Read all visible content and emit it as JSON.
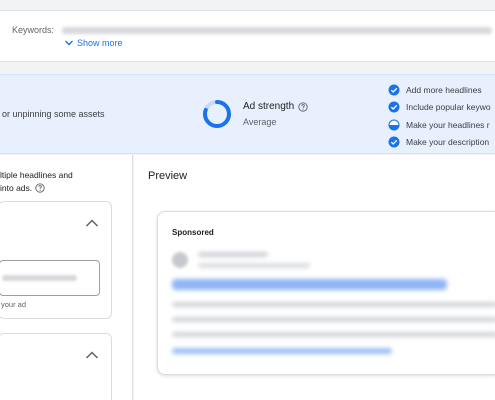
{
  "keywords": {
    "label": "Keywords:",
    "show_more": "Show more"
  },
  "banner": {
    "pin_text": "or unpinning some assets",
    "ad_strength_title": "Ad strength",
    "ad_strength_value": "Average",
    "ring_level": 0.8,
    "suggestions": [
      {
        "text": "Add more headlines",
        "icon": "check-circle-icon"
      },
      {
        "text": "Include popular keywo",
        "icon": "check-circle-icon"
      },
      {
        "text": "Make your headlines r",
        "icon": "half-circle-icon"
      },
      {
        "text": "Make your description",
        "icon": "check-circle-icon"
      }
    ]
  },
  "left": {
    "desc_line1": "ltiple headlines and",
    "desc_line2": "into ads.",
    "input_help": "your ad"
  },
  "preview": {
    "title": "Preview",
    "sponsored": "Sponsored"
  },
  "colors": {
    "accent": "#1a73e8",
    "banner_bg": "#e8f0fe",
    "link_blurred": "#7aa7f5"
  }
}
